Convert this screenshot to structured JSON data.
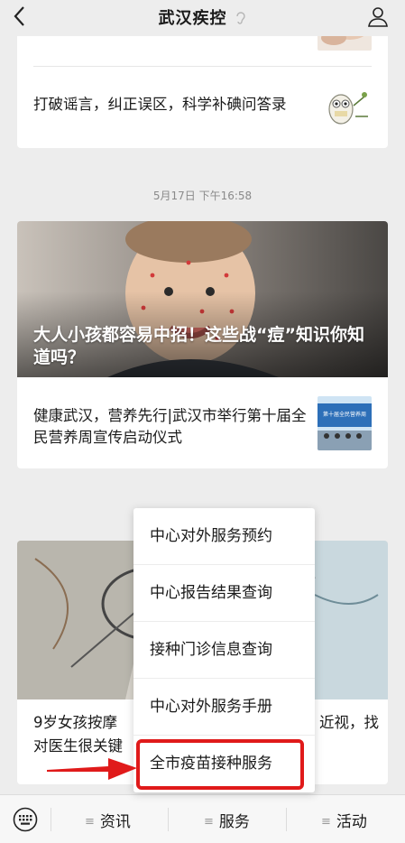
{
  "header": {
    "title": "武汉疾控"
  },
  "feed": {
    "card1": {
      "item_text": "打破谣言，纠正误区，科学补碘问答录"
    },
    "timestamp": "5月17日 下午16:58",
    "card2": {
      "cover_title": "大人小孩都容易中招！这些战“痘”知识你知道吗？",
      "item_text": "健康武汉，营养先行|武汉市举行第十届全民营养周宣传启动仪式"
    },
    "card3": {
      "item_text_left": "9岁女孩按摩",
      "item_text_right": "近视，找",
      "item_text_line2": "对医生很关键"
    }
  },
  "popup_menu": {
    "items": [
      "中心对外服务预约",
      "中心报告结果查询",
      "接种门诊信息查询",
      "中心对外服务手册",
      "全市疫苗接种服务"
    ]
  },
  "bottom_nav": {
    "tabs": [
      "资讯",
      "服务",
      "活动"
    ]
  },
  "colors": {
    "highlight": "#e01a1a",
    "background": "#ededed"
  }
}
